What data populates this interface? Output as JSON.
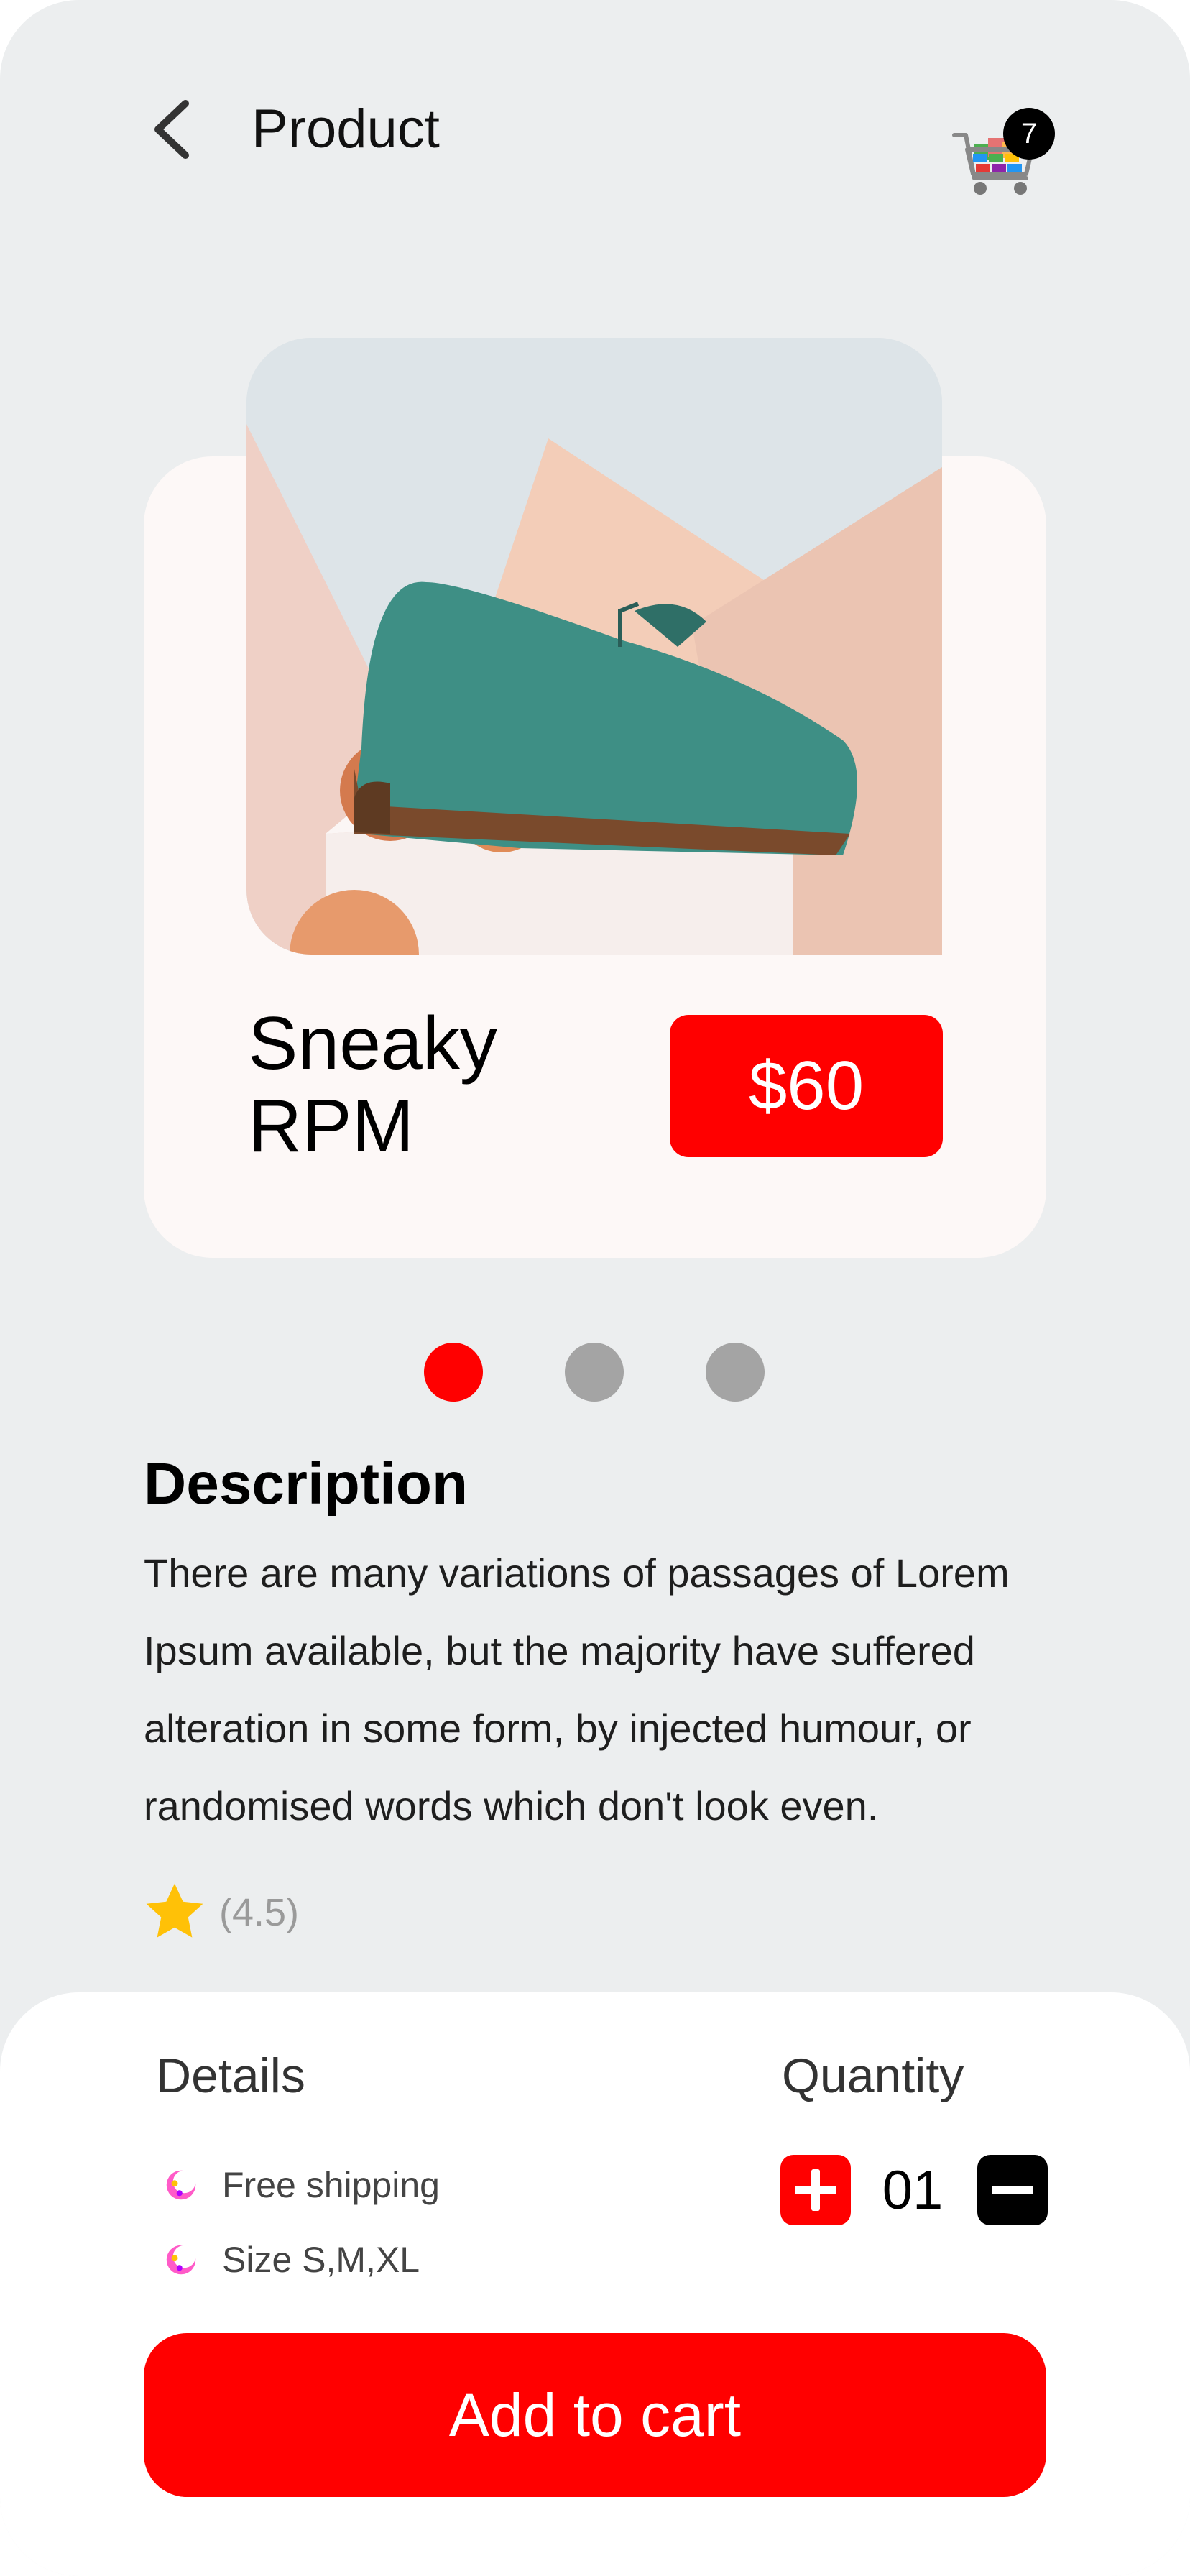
{
  "header": {
    "title": "Product",
    "back_icon": "chevron-left-icon",
    "cart_icon": "shopping-cart-icon",
    "cart_count": "7"
  },
  "product": {
    "name": "Sneaky RPM",
    "price": "$60",
    "image": "green-suede-brogue-shoe-with-peaches"
  },
  "carousel": {
    "active_index": 0,
    "dot_count": 3
  },
  "description": {
    "heading": "Description",
    "text": "There are many variations of passages of Lorem Ipsum available, but the majority have suffered alteration in some form, by injected humour, or randomised words which don't look even.",
    "rating": "(4.5)",
    "rating_icon": "star-icon"
  },
  "details": {
    "heading": "Details",
    "items": [
      {
        "label": "Free shipping",
        "icon": "sparkle-bullet-icon"
      },
      {
        "label": "Size S,M,XL",
        "icon": "sparkle-bullet-icon"
      }
    ]
  },
  "quantity": {
    "heading": "Quantity",
    "value": "01",
    "plus_icon": "plus-icon",
    "minus_icon": "minus-icon"
  },
  "cta": {
    "label": "Add to cart"
  },
  "colors": {
    "accent": "#FF0000",
    "background": "#ECEEEF",
    "card": "#FDF8F7",
    "dot_inactive": "#A4A4A4",
    "star": "#FFC107"
  }
}
